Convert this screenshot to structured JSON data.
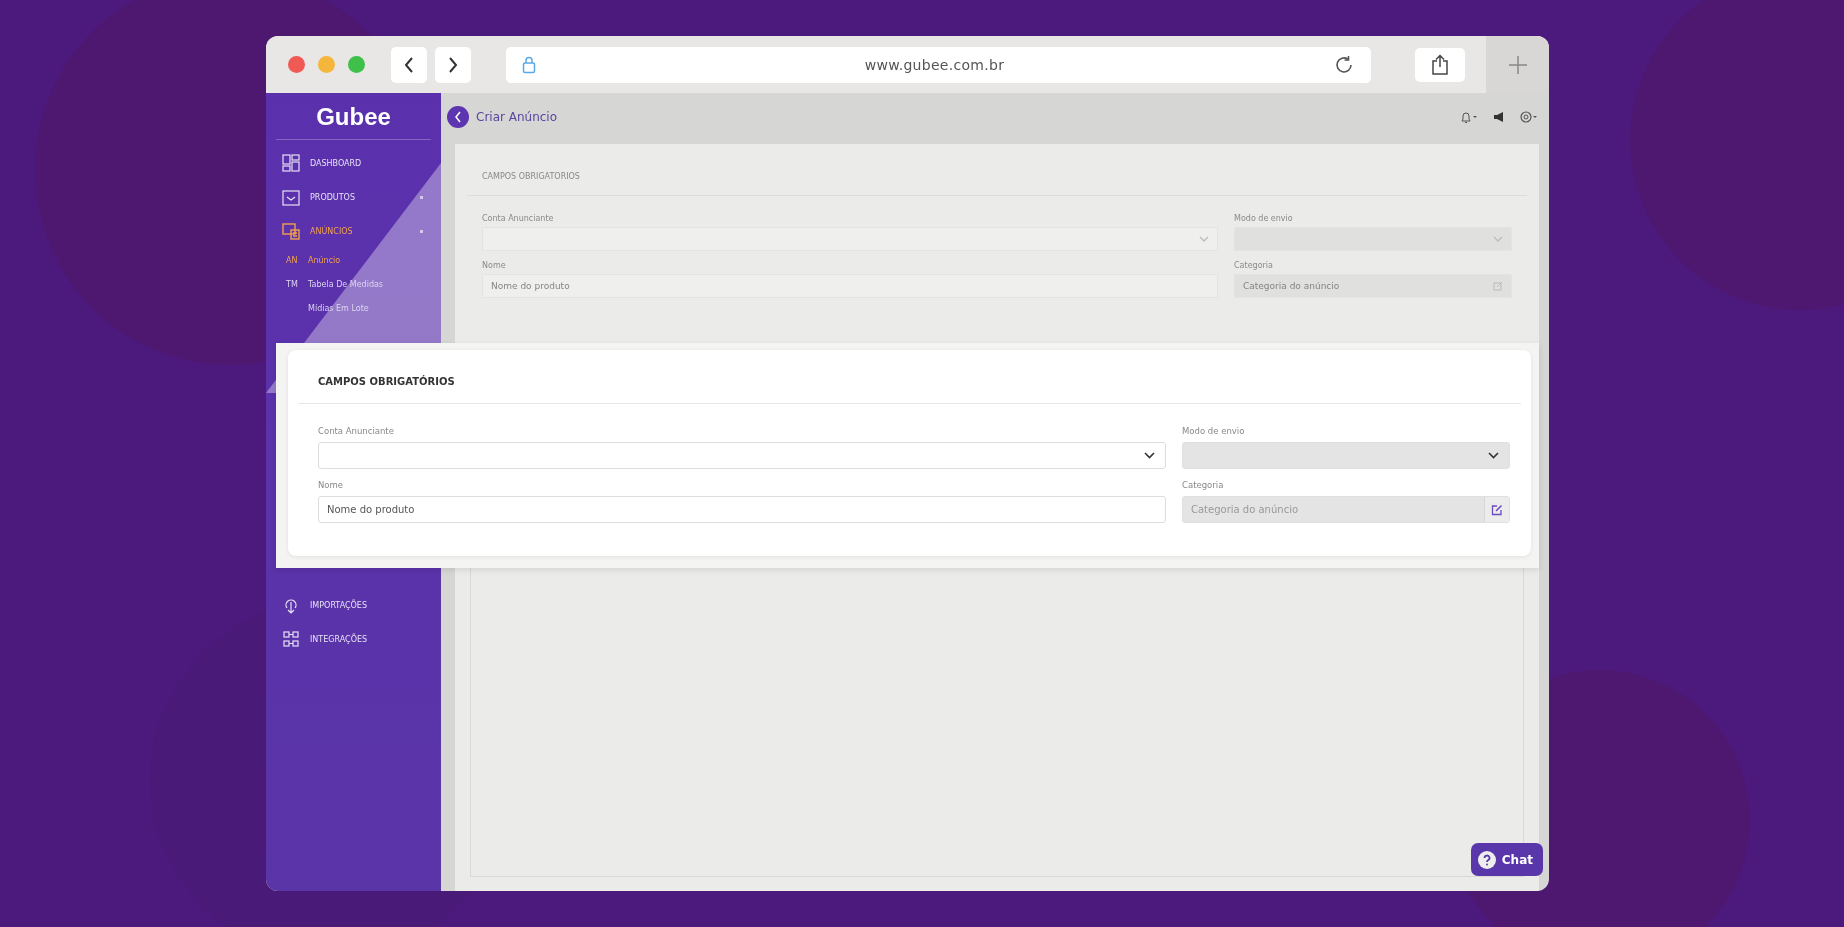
{
  "browser": {
    "url": "www.gubee.com.br"
  },
  "sidebar": {
    "logo": "Gubee",
    "items": [
      {
        "label": "DASHBOARD",
        "kind": "grid",
        "selected": false,
        "expandable": false
      },
      {
        "label": "PRODUTOS",
        "kind": "box",
        "selected": false,
        "expandable": true
      },
      {
        "label": "ANÚNCIOS",
        "kind": "ads",
        "selected": true,
        "expandable": true
      }
    ],
    "subitems": [
      {
        "prefix": "AN",
        "label": "Anúncio",
        "selected": true
      },
      {
        "prefix": "TM",
        "label": "Tabela De Medidas",
        "selected": false
      },
      {
        "label": "Mídias Em Lote",
        "selected": false
      }
    ],
    "lower_items": [
      {
        "label": "IMPORTAÇÕES",
        "kind": "import",
        "selected": false,
        "expandable": false
      },
      {
        "label": "INTEGRAÇÕES",
        "kind": "plug",
        "selected": false,
        "expandable": false
      }
    ]
  },
  "header": {
    "title": "Criar Anúncio"
  },
  "background_form": {
    "title": "CAMPOS OBRIGATORIOS",
    "fields": [
      {
        "label": "Conta Anunciante",
        "kind": "select",
        "disabled": false
      },
      {
        "label": "Modo de envio",
        "kind": "select",
        "disabled": true
      },
      {
        "label": "Nome",
        "kind": "text",
        "placeholder": "Nome do produto",
        "disabled": false
      },
      {
        "label": "Categoria",
        "kind": "picker",
        "placeholder": "Categoria do anúncio",
        "disabled": true
      }
    ]
  },
  "card": {
    "title": "CAMPOS OBRIGATÓRIOS",
    "fields": [
      {
        "label": "Conta Anunciante",
        "kind": "select",
        "disabled": false
      },
      {
        "label": "Modo de envio",
        "kind": "select",
        "disabled": true
      },
      {
        "label": "Nome",
        "kind": "text",
        "placeholder": "Nome do produto",
        "disabled": false
      },
      {
        "label": "Categoria",
        "kind": "picker",
        "placeholder": "Categoria do anúncio",
        "disabled": true
      }
    ]
  },
  "chat": {
    "label": "Chat"
  }
}
